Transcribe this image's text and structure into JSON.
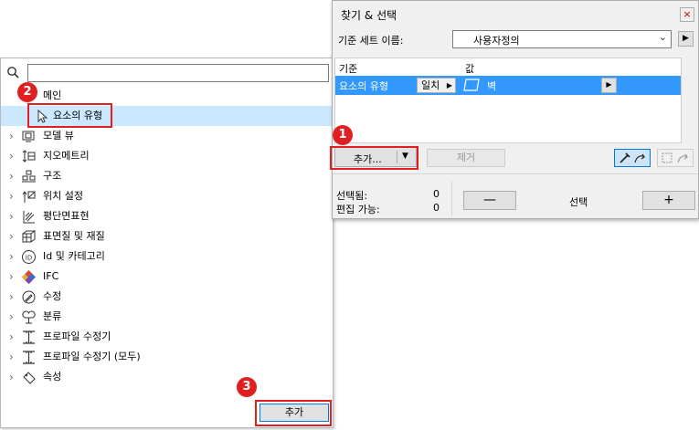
{
  "find_select": {
    "title": "찾기 & 선택",
    "close_label": "×",
    "set_name_label": "기준 세트 이름:",
    "set_name_value": "사용자정의",
    "grid": {
      "col_criteria": "기준",
      "col_value": "값",
      "row": {
        "criteria": "요소의 유형",
        "match": "일치",
        "value": "벽"
      }
    },
    "add_label": "추가...",
    "remove_label": "제거",
    "selected_label": "선택됨:",
    "selected_count": "0",
    "editable_label": "편집 가능:",
    "editable_count": "0",
    "minus_label": "—",
    "select_label": "선택",
    "plus_label": "+"
  },
  "criteria_list": {
    "search_placeholder": "",
    "items": [
      {
        "label": "메인",
        "icon": "none"
      },
      {
        "label": "요소의 유형",
        "icon": "cursor-icon"
      },
      {
        "label": "모델 뷰",
        "icon": "model-view-icon"
      },
      {
        "label": "지오메트리",
        "icon": "geometry-icon"
      },
      {
        "label": "구조",
        "icon": "structure-icon"
      },
      {
        "label": "위치 설정",
        "icon": "positioning-icon"
      },
      {
        "label": "평단면표현",
        "icon": "floor-plan-icon"
      },
      {
        "label": "표면질 및 재질",
        "icon": "surface-icon"
      },
      {
        "label": "Id 및 카테고리",
        "icon": "id-icon"
      },
      {
        "label": "IFC",
        "icon": "ifc-icon"
      },
      {
        "label": "수정",
        "icon": "modify-icon"
      },
      {
        "label": "분류",
        "icon": "classification-icon"
      },
      {
        "label": "프로파일 수정기",
        "icon": "profile-modifier-icon"
      },
      {
        "label": "프로파일 수정기 (모두)",
        "icon": "profile-modifier-icon"
      },
      {
        "label": "속성",
        "icon": "property-icon"
      }
    ],
    "add_button_label": "추가"
  },
  "callouts": [
    "1",
    "2",
    "3"
  ],
  "colors": {
    "callout": "#e02020",
    "selection": "#3399ff",
    "tree_selection": "#cce8ff"
  }
}
